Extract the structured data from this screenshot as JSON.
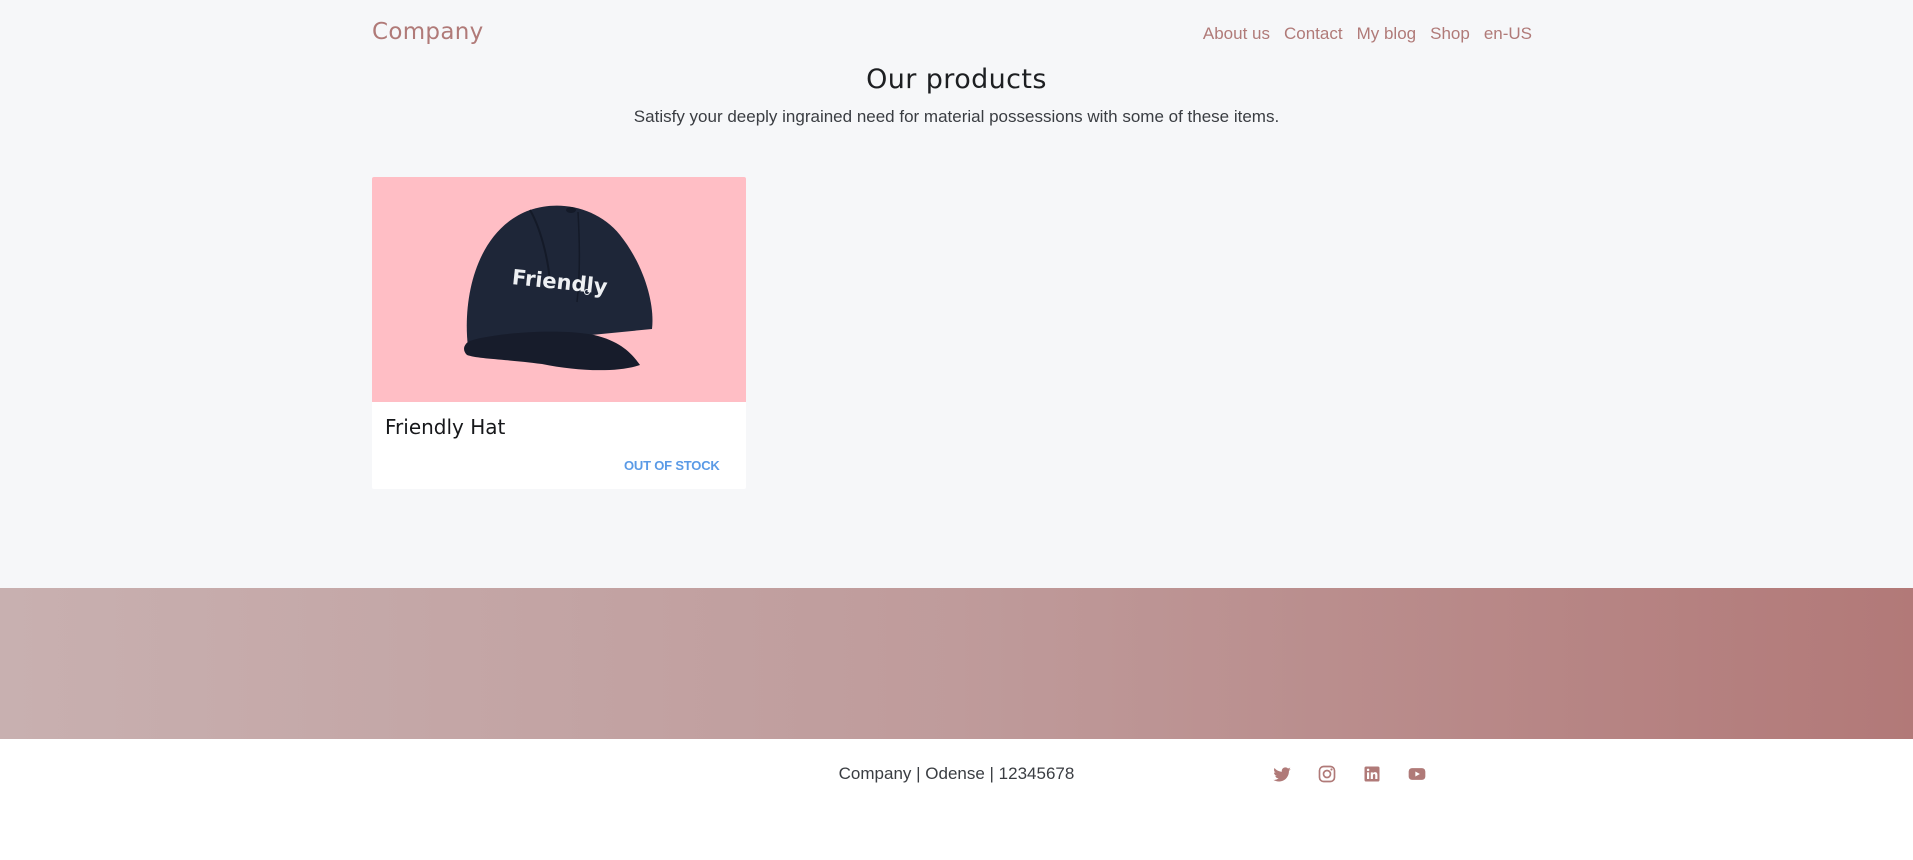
{
  "header": {
    "brand": "Company",
    "nav": [
      "About us",
      "Contact",
      "My blog",
      "Shop",
      "en-US"
    ]
  },
  "hero": {
    "title": "Our products",
    "subtitle": "Satisfy your deeply ingrained need for material possessions with some of these items."
  },
  "products": [
    {
      "name": "Friendly Hat",
      "status": "OUT OF STOCK",
      "image_text": "Friendly"
    }
  ],
  "footer": {
    "text": "Company | Odense | 12345678",
    "social_icons": [
      "twitter-icon",
      "instagram-icon",
      "linkedin-icon",
      "youtube-icon"
    ]
  },
  "colors": {
    "accent": "#b07a78",
    "background": "#f6f7f9",
    "product_bg": "#ffbec5",
    "stock_status": "#5a9ae6"
  }
}
